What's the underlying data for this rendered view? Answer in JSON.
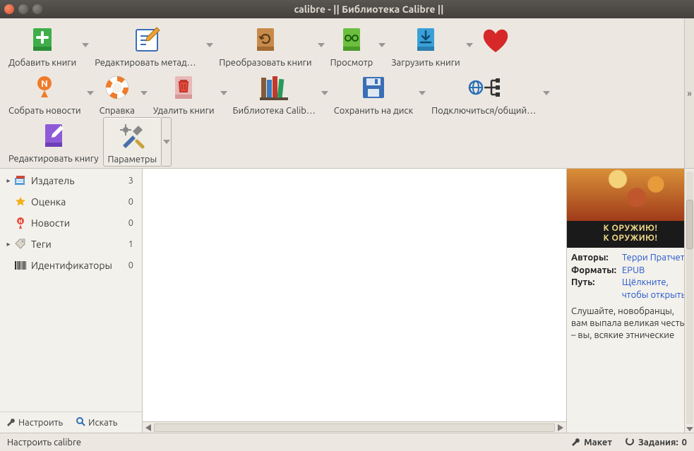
{
  "window": {
    "title": "calibre - || Библиотека Calibre ||"
  },
  "colors": {
    "accent_green": "#3fae49",
    "accent_orange": "#e87b2a",
    "accent_red": "#d7512c",
    "link": "#2255cc"
  },
  "toolbar": {
    "row1": [
      {
        "id": "add-books",
        "label": "Добавить книги",
        "dropdown": true
      },
      {
        "id": "edit-metadata",
        "label": "Редактировать метаданные",
        "dropdown": true
      },
      {
        "id": "convert-books",
        "label": "Преобразовать книги",
        "dropdown": true
      },
      {
        "id": "view",
        "label": "Просмотр",
        "dropdown": true
      },
      {
        "id": "fetch-news",
        "label": "Загрузить книги",
        "dropdown": true
      },
      {
        "id": "donate",
        "label": "",
        "dropdown": false
      }
    ],
    "row2": [
      {
        "id": "gather-news",
        "label": "Собрать новости",
        "dropdown": true
      },
      {
        "id": "help",
        "label": "Справка",
        "dropdown": true
      },
      {
        "id": "remove-books",
        "label": "Удалить книги",
        "dropdown": true
      },
      {
        "id": "library",
        "label": "Библиотека Calib…",
        "dropdown": true
      },
      {
        "id": "save-to-disk",
        "label": "Сохранить на диск",
        "dropdown": true
      },
      {
        "id": "connect-share",
        "label": "Подключиться/общий доступ",
        "dropdown": true
      }
    ],
    "row3": [
      {
        "id": "edit-book",
        "label": "Редактировать книгу",
        "dropdown": false
      },
      {
        "id": "preferences",
        "label": "Параметры",
        "dropdown": true,
        "framed": true
      }
    ]
  },
  "sidebar": {
    "items": [
      {
        "id": "publisher",
        "label": "Издатель",
        "count": "3",
        "expandable": true
      },
      {
        "id": "rating",
        "label": "Оценка",
        "count": "0",
        "expandable": false
      },
      {
        "id": "news",
        "label": "Новости",
        "count": "0",
        "expandable": false
      },
      {
        "id": "tags",
        "label": "Теги",
        "count": "1",
        "expandable": true
      },
      {
        "id": "identifiers",
        "label": "Идентификаторы",
        "count": "0",
        "expandable": false
      }
    ],
    "footer": {
      "configure": "Настроить",
      "search": "Искать"
    }
  },
  "details": {
    "cover_line1": "К ОРУЖИЮ!",
    "cover_line2": "К ОРУЖИЮ!",
    "meta": {
      "authors_k": "Авторы:",
      "authors_v": "Терри Пратчетт",
      "formats_k": "Форматы:",
      "formats_v": "EPUB",
      "path_k": "Путь:",
      "path_v": "Щёлкните, чтобы открыть"
    },
    "description": "Слушайте, новобранцы, вам выпала великая честь – вы, всякие этнические"
  },
  "statusbar": {
    "hint": "Настроить calibre",
    "layout": "Макет",
    "jobs_label": "Задания:",
    "jobs_count": "0"
  }
}
